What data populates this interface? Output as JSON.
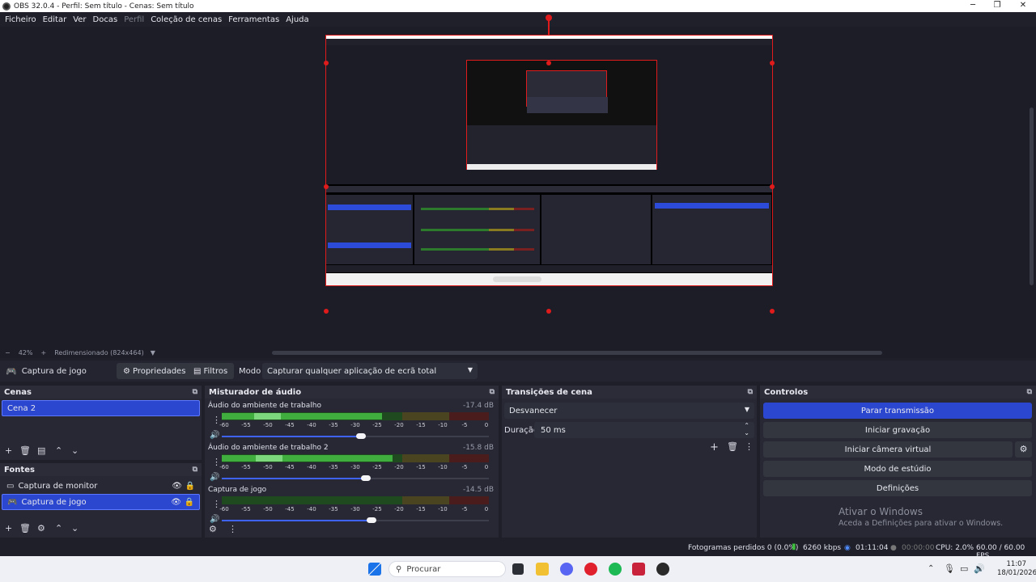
{
  "window": {
    "title": "OBS 32.0.4 - Perfil: Sem título - Cenas: Sem título",
    "controls": [
      "─",
      "❐",
      "✕"
    ]
  },
  "menu": [
    "Ficheiro",
    "Editar",
    "Ver",
    "Docas",
    "Perfil",
    "Coleção de cenas",
    "Ferramentas",
    "Ajuda"
  ],
  "preview": {
    "zoom": "42%",
    "resize_info": "Redimensionado (824x464)"
  },
  "source_toolbar": {
    "source_name": "Captura de jogo",
    "properties": "Propriedades",
    "filters": "Filtros",
    "mode_label": "Modo",
    "mode_value": "Capturar qualquer aplicação de ecrã total"
  },
  "scenes": {
    "title": "Cenas",
    "items": [
      "Cena 2"
    ]
  },
  "sources": {
    "title": "Fontes",
    "items": [
      {
        "name": "Captura de monitor",
        "icon": "monitor-icon"
      },
      {
        "name": "Captura de jogo",
        "icon": "gamepad-icon"
      }
    ]
  },
  "mixer": {
    "title": "Misturador de áudio",
    "scale": [
      "-60",
      "-55",
      "-50",
      "-45",
      "-40",
      "-35",
      "-30",
      "-25",
      "-20",
      "-15",
      "-10",
      "-5",
      "0"
    ],
    "channels": [
      {
        "name": "Áudio do ambiente de trabalho",
        "db": "-17.4 dB",
        "level": 0.6,
        "volume": 0.52
      },
      {
        "name": "Áudio do ambiente de trabalho 2",
        "db": "-15.8 dB",
        "level": 0.64,
        "volume": 0.54
      },
      {
        "name": "Captura de jogo",
        "db": "-14.5 dB",
        "level": 0.0,
        "volume": 0.56
      }
    ]
  },
  "transitions": {
    "title": "Transições de cena",
    "selected": "Desvanecer",
    "duration_label": "Duração",
    "duration_value": "50 ms"
  },
  "controls": {
    "title": "Controlos",
    "buttons": [
      "Parar transmissão",
      "Iniciar gravação",
      "Iniciar câmera virtual",
      "Modo de estúdio",
      "Definições"
    ]
  },
  "activation": {
    "title": "Ativar o Windows",
    "subtitle": "Aceda a Definições para ativar o Windows."
  },
  "status": {
    "dropped": "Fotogramas perdidos 0 (0.0%)",
    "bitrate": "6260 kbps",
    "stream_time": "01:11:04",
    "rec_time": "00:00:00",
    "cpu": "CPU: 2.0%",
    "fps": "60.00 / 60.00 FPS"
  },
  "taskbar": {
    "search_placeholder": "Procurar",
    "time": "11:07",
    "date": "18/01/2026"
  },
  "colors": {
    "accent": "#2c47cf",
    "selection_border": "#e01b1b",
    "meter_green": "#2d7a2d",
    "meter_yellow": "#8a7a20",
    "meter_red": "#7a2020"
  }
}
